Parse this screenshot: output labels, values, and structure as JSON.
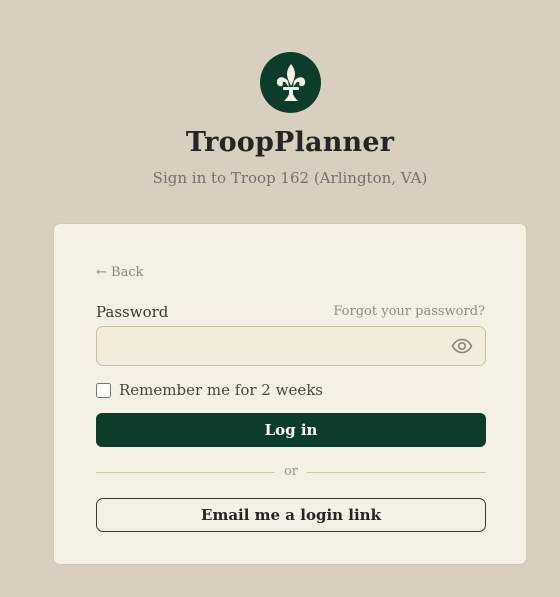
{
  "app": {
    "title": "TroopPlanner",
    "subtitle": "Sign in to Troop 162 (Arlington, VA)",
    "logo_icon": "fleur-de-lis-icon"
  },
  "login_form": {
    "back_label": "← Back",
    "password_label": "Password",
    "forgot_password_label": "Forgot your password?",
    "password_value": "",
    "password_placeholder": "",
    "show_password_icon": "eye-icon",
    "remember_label": "Remember me for 2 weeks",
    "remember_checked": false,
    "login_label": "Log in",
    "divider_text": "or",
    "email_link_label": "Email me a login link"
  },
  "colors": {
    "page_background": "#d8cfbf",
    "card_background": "#f5f0e5",
    "brand_green": "#0c3d2a"
  }
}
